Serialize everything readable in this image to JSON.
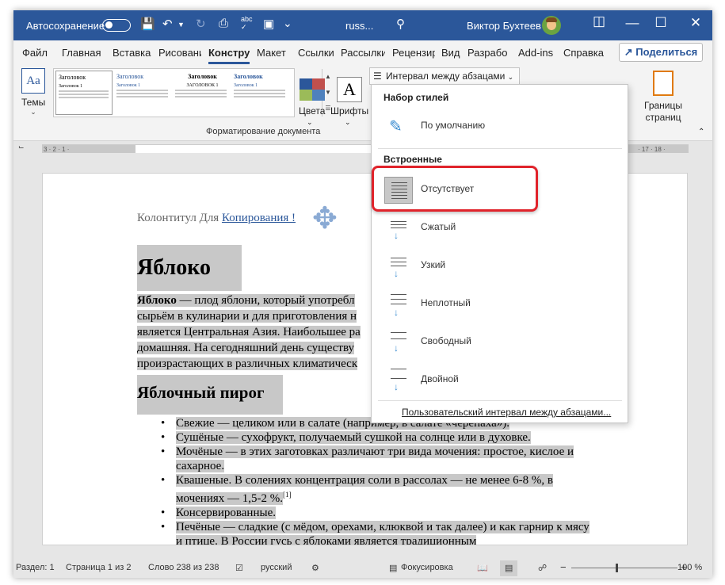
{
  "titlebar": {
    "autosave_label": "Автосохранение",
    "doc_name": "russ...",
    "user_name": "Виктор Бухтеев",
    "minimize": "—",
    "maximize": "☐",
    "close": "✕"
  },
  "menu": {
    "tabs": [
      "Файл",
      "Главная",
      "Вставка",
      "Рисовани",
      "Конструктор",
      "Макет",
      "Ссылки",
      "Рассылки",
      "Рецензир",
      "Вид",
      "Разрабо",
      "Add-ins",
      "Справка"
    ],
    "share": "Поделиться"
  },
  "ribbon": {
    "themes": "Темы",
    "colors": "Цвета",
    "fonts": "Шрифты",
    "spacing": "Интервал между абзацами",
    "group_label": "Форматирование документа",
    "page_borders": "Границы страниц",
    "gallery": [
      {
        "title": "Заголовок",
        "h1": "Заголовок 1"
      },
      {
        "title": "Заголовок",
        "h1": "Заголовок 1"
      },
      {
        "title": "Заголовок",
        "h1": "ЗАГОЛОВОК 1"
      },
      {
        "title": "Заголовок",
        "h1": "Заголовок 1"
      }
    ]
  },
  "ruler": {
    "left": "3 · 2 · 1 ·",
    "right": "· 17 · 18 ·"
  },
  "document": {
    "header_prefix": "Колонтитул Для ",
    "header_link": "Копирования !",
    "heading1": "Яблоко",
    "para_bold": "Яблоко",
    "para_lines": [
      " — плод яблони, который употребл",
      "сырьём в кулинарии и для приготовления н",
      "является Центральная Азия. Наибольшее ра",
      "домашняя. На сегодняшний день существу",
      "произрастающих в различных климатическ"
    ],
    "heading2": "Яблочный пирог",
    "list": [
      "Свежие — целиком или в салате (например, в салате «черепаха»).",
      "Сушёные — сухофрукт, получаемый сушкой на солнце или в духовке.",
      "Мочёные — в этих заготовках различают три вида мочения: простое, кислое и сахарное.",
      "Квашеные. В солениях концентрация соли в рассолах — не менее 6-8 %, в мочениях — 1,5-2 %.",
      "Консервированные.",
      "Печёные — сладкие (с мёдом, орехами, клюквой и так далее) и как гарнир к мясу и птице. В России гусь с яблоками является традиционным"
    ],
    "footnote": "[1]"
  },
  "dropdown": {
    "header_style_set": "Набор стилей",
    "default": "По умолчанию",
    "header_builtin": "Встроенные",
    "items": [
      "Отсутствует",
      "Сжатый",
      "Узкий",
      "Неплотный",
      "Свободный",
      "Двойной"
    ],
    "custom": "Пользовательский интервал между абзацами..."
  },
  "status": {
    "section": "Раздел: 1",
    "page": "Страница 1 из 2",
    "words": "Слово 238 из 238",
    "language": "русский",
    "focus": "Фокусировка",
    "zoom": "100 %",
    "zoom_minus": "−",
    "zoom_plus": "+"
  },
  "colors": {
    "title_bg": "#2b579a",
    "accent": "#2b579a",
    "highlight": "#c8c8c8",
    "callout": "#e0232b"
  }
}
